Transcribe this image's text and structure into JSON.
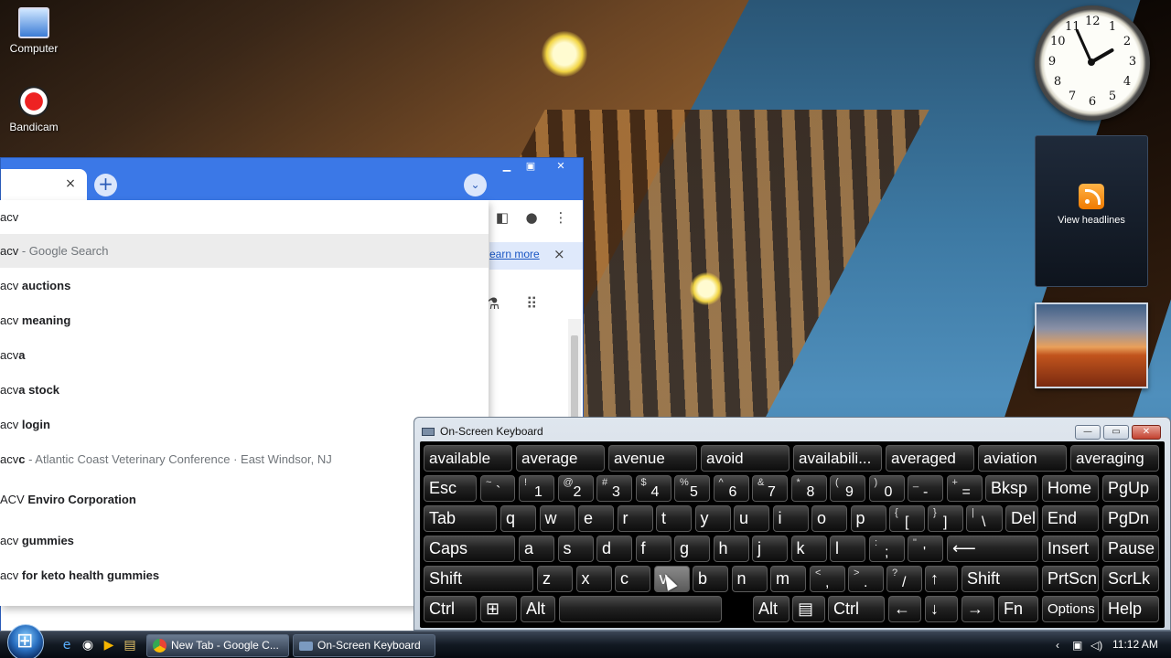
{
  "desktop": {
    "icons": [
      {
        "label": "Computer",
        "icon": "computer-icon"
      },
      {
        "label": "Bandicam",
        "icon": "bandicam-icon"
      }
    ],
    "gadgets": {
      "clock": {
        "numbers": [
          "12",
          "1",
          "2",
          "3",
          "4",
          "5",
          "6",
          "7",
          "8",
          "9",
          "10",
          "11"
        ],
        "time": "11:12"
      },
      "feed": {
        "label": "View headlines",
        "icon": "rss-icon"
      }
    }
  },
  "chrome": {
    "window_controls": {
      "minimize": "▁",
      "maximize": "▣",
      "close": "✕"
    },
    "tab_close": "×",
    "new_tab": "+",
    "tab_search": "⌄",
    "toolbar_icons": [
      "sidebar-icon",
      "profile-icon",
      "menu-icon"
    ],
    "infobar": {
      "link": "earn more",
      "close": "×"
    },
    "omnibox": {
      "value": "acv",
      "suggestions": [
        {
          "typed": "acv",
          "rest": "",
          "dim": " - Google Search",
          "selected": true
        },
        {
          "typed": "acv ",
          "rest": "auctions",
          "dim": ""
        },
        {
          "typed": "acv ",
          "rest": "meaning",
          "dim": ""
        },
        {
          "typed": "acv",
          "rest": "a",
          "dim": ""
        },
        {
          "typed": "acv",
          "rest": "a stock",
          "dim": ""
        },
        {
          "typed": "acv ",
          "rest": "login",
          "dim": ""
        },
        {
          "typed": "acv",
          "rest": "c",
          "dim": " - Atlantic Coast Veterinary Conference · East Windsor, NJ"
        },
        {
          "typed": "ACV ",
          "rest": "Enviro Corporation",
          "dim": ""
        },
        {
          "typed": "acv ",
          "rest": "gummies",
          "dim": ""
        },
        {
          "typed": "acv ",
          "rest": "for keto health gummies",
          "dim": ""
        }
      ]
    }
  },
  "osk": {
    "title": "On-Screen Keyboard",
    "controls": {
      "minimize": "—",
      "restore": "▭",
      "close": "✕"
    },
    "predictions": [
      "available",
      "average",
      "avenue",
      "avoid",
      "availabili...",
      "averaged",
      "aviation",
      "averaging"
    ],
    "keys": {
      "esc": "Esc",
      "tilde_shift": "~",
      "tilde_base": "`",
      "num": [
        [
          "!",
          "1"
        ],
        [
          "@",
          "2"
        ],
        [
          "#",
          "3"
        ],
        [
          "$",
          "4"
        ],
        [
          "%",
          "5"
        ],
        [
          "^",
          "6"
        ],
        [
          "&",
          "7"
        ],
        [
          "*",
          "8"
        ],
        [
          "(",
          "9"
        ],
        [
          ")",
          "0"
        ],
        [
          "_",
          "-"
        ],
        [
          "+",
          "="
        ]
      ],
      "bksp": "Bksp",
      "home": "Home",
      "pgup": "PgUp",
      "tab": "Tab",
      "row2": [
        "q",
        "w",
        "e",
        "r",
        "t",
        "y",
        "u",
        "i",
        "o",
        "p"
      ],
      "lbrace": [
        "{",
        "["
      ],
      "rbrace": [
        "}",
        "]"
      ],
      "pipe": [
        "|",
        "\\"
      ],
      "del": "Del",
      "end": "End",
      "pgdn": "PgDn",
      "caps": "Caps",
      "row3": [
        "a",
        "s",
        "d",
        "f",
        "g",
        "h",
        "j",
        "k",
        "l"
      ],
      "colon": [
        ":",
        ";"
      ],
      "quote": [
        "\"",
        "'"
      ],
      "enter": "⟵",
      "insert": "Insert",
      "pause": "Pause",
      "shift": "Shift",
      "row4": [
        "z",
        "x",
        "c",
        "v",
        "b",
        "n",
        "m"
      ],
      "lt": [
        "<",
        ","
      ],
      "gt": [
        ">",
        "."
      ],
      "q": [
        "?",
        "/"
      ],
      "up": "↑",
      "shift_r": "Shift",
      "prtscn": "PrtScn",
      "scrlk": "ScrLk",
      "ctrl": "Ctrl",
      "win": "⊞",
      "alt": "Alt",
      "alt_r": "Alt",
      "menu": "▤",
      "ctrl_r": "Ctrl",
      "left": "←",
      "down": "↓",
      "right": "→",
      "fn": "Fn",
      "options": "Options",
      "help": "Help"
    }
  },
  "taskbar": {
    "quicklaunch": [
      "ie-icon",
      "chrome-icon",
      "media-player-icon",
      "explorer-icon"
    ],
    "tasks": [
      {
        "label": "New Tab - Google C...",
        "icon": "chrome-icon"
      },
      {
        "label": "On-Screen Keyboard",
        "icon": "keyboard-icon"
      }
    ],
    "tray": {
      "time": "11:12 AM"
    }
  }
}
